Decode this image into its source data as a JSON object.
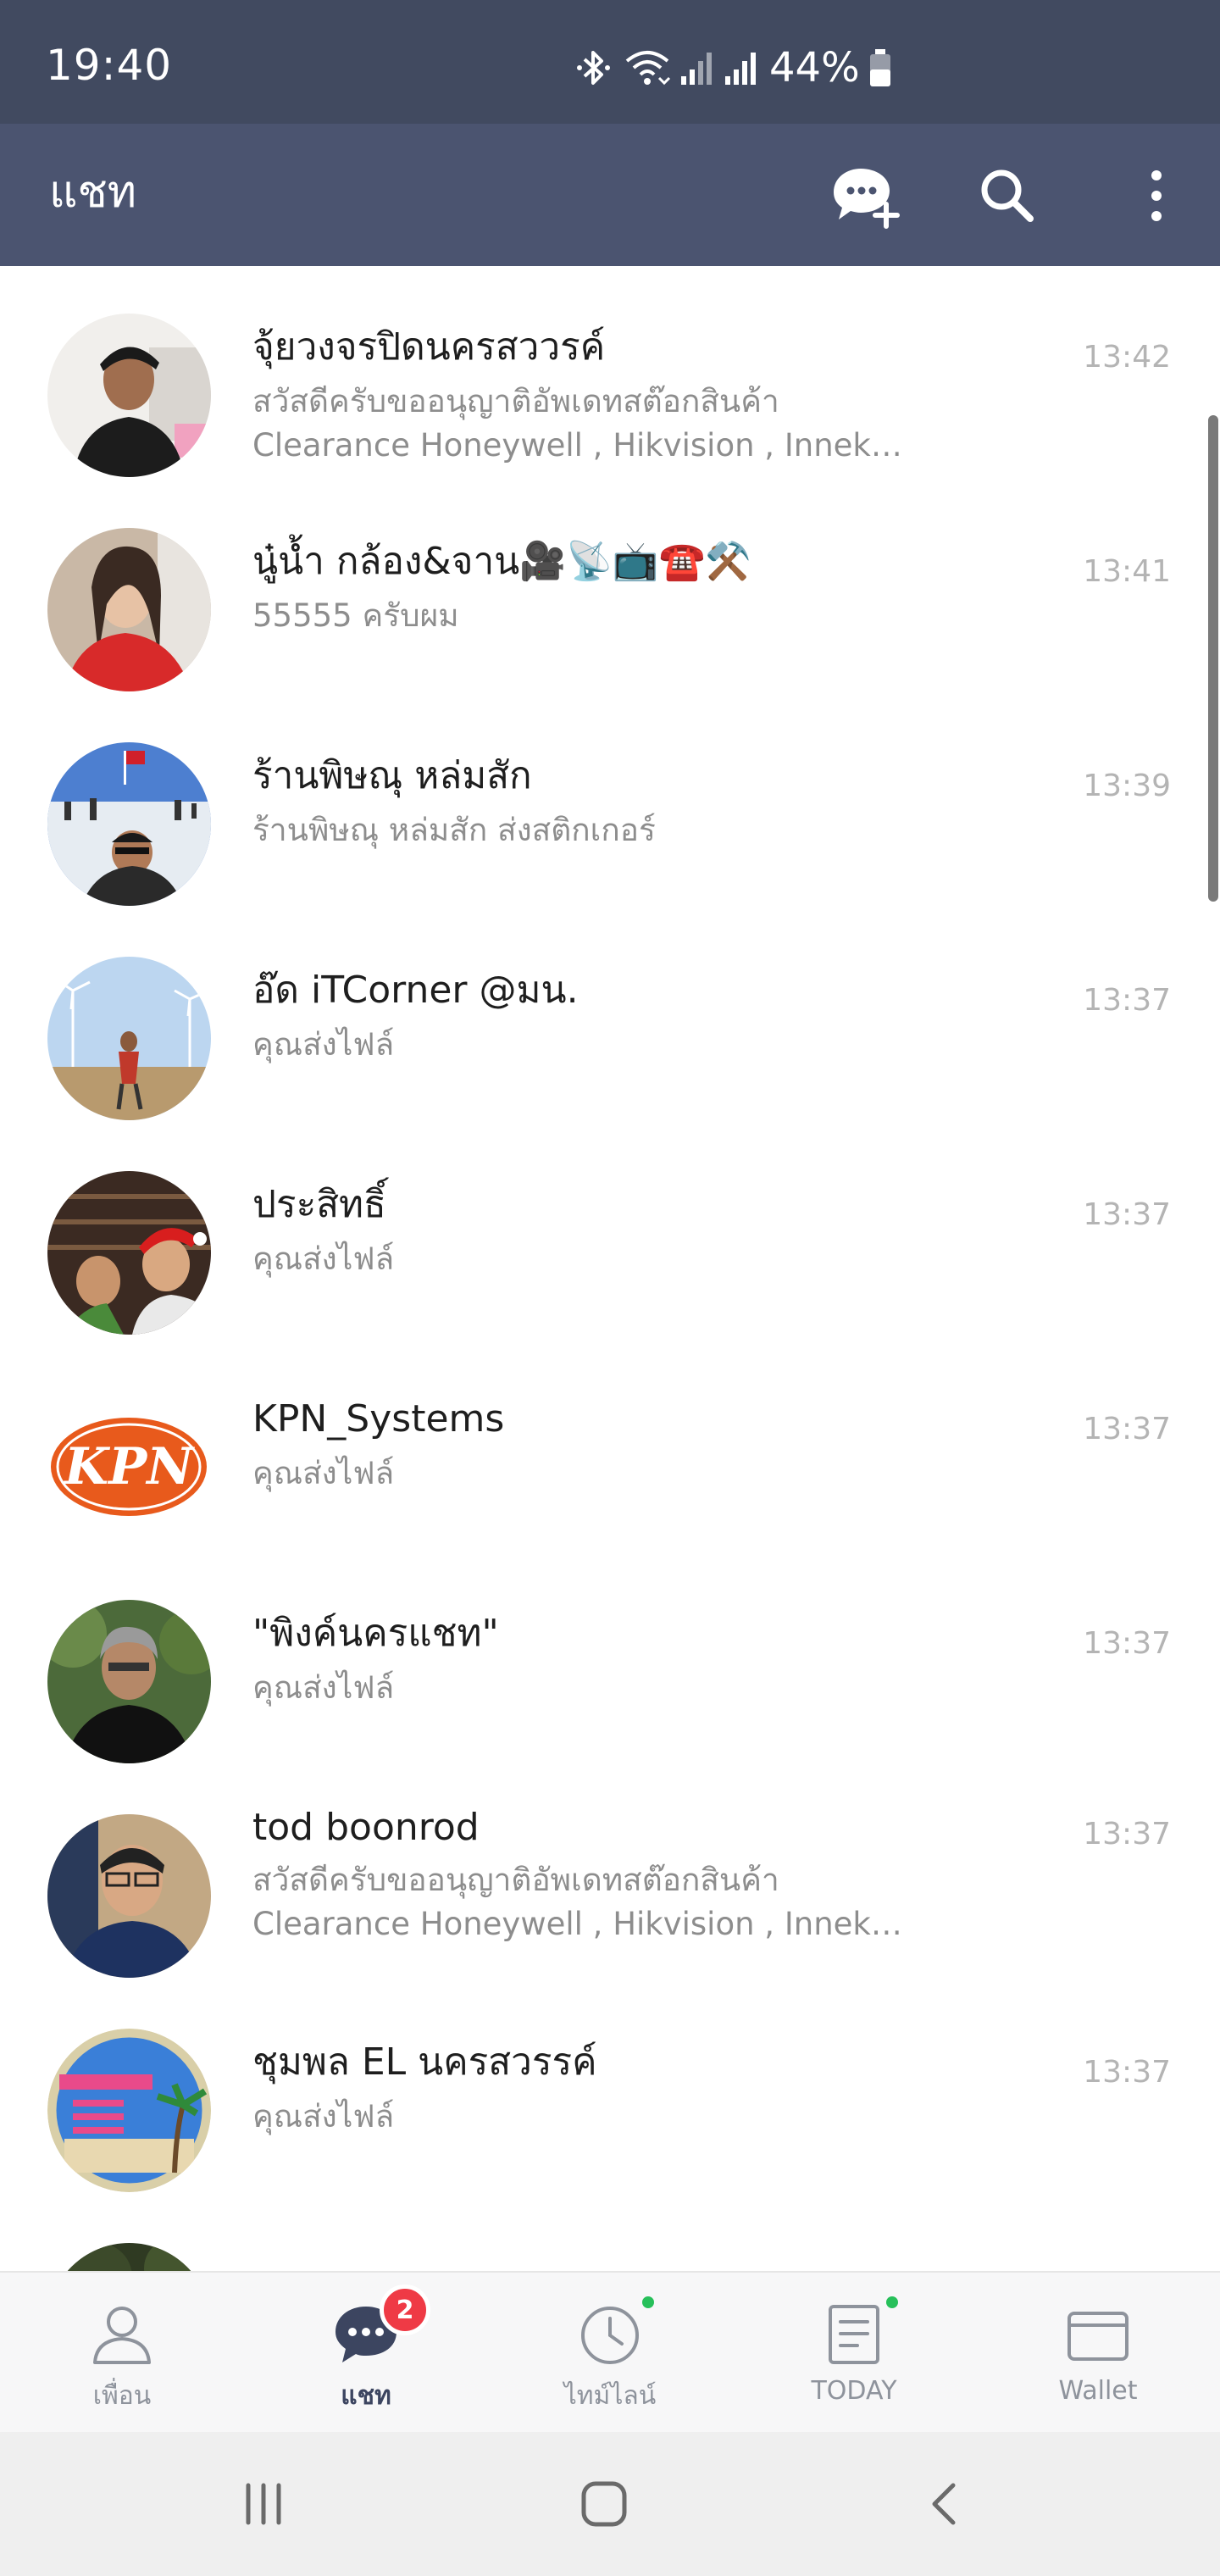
{
  "status_bar": {
    "time": "19:40",
    "battery": "44%"
  },
  "header": {
    "title": "แชท"
  },
  "chats": [
    {
      "name": "จุ้ยวงจรปิดนครสววรค์",
      "message": "สวัสดีครับขออนุญาติอัพเดทสต๊อกสินค้า",
      "message2": "Clearance Honeywell , Hikvision , Innekt ...",
      "time": "13:42"
    },
    {
      "name": "นู๋น้ำ กล้อง&จาน🎥📡📺☎️⚒️",
      "message": "55555 ครับผม",
      "time": "13:41"
    },
    {
      "name": "ร้านพิษณุ หล่มสัก",
      "message": "ร้านพิษณุ หล่มสัก ส่งสติกเกอร์",
      "time": "13:39"
    },
    {
      "name": "อ๊ด  iTCorner @มน.",
      "message": "คุณส่งไฟล์",
      "time": "13:37"
    },
    {
      "name": "ประสิทธิ์",
      "message": "คุณส่งไฟล์",
      "time": "13:37"
    },
    {
      "name": "KPN_Systems",
      "message": "คุณส่งไฟล์",
      "time": "13:37"
    },
    {
      "name": "\"พิงค์นครแชท\"",
      "message": "คุณส่งไฟล์",
      "time": "13:37"
    },
    {
      "name": "tod   boonrod",
      "message": "สวัสดีครับขออนุญาติอัพเดทสต๊อกสินค้า",
      "message2": "Clearance Honeywell , Hikvision , Innekt ...",
      "time": "13:37"
    },
    {
      "name": "ชุมพล EL นครสวรรค์",
      "message": "คุณส่งไฟล์",
      "time": "13:37"
    }
  ],
  "avatars": {
    "kpn_logo_text": "KPN"
  },
  "tabs": [
    {
      "label": "เพื่อน",
      "icon": "person-icon"
    },
    {
      "label": "แชท",
      "icon": "chat-bubble-icon",
      "badge": "2",
      "active": true
    },
    {
      "label": "ไทม์ไลน์",
      "icon": "clock-icon"
    },
    {
      "label": "TODAY",
      "icon": "news-icon"
    },
    {
      "label": "Wallet",
      "icon": "wallet-icon"
    }
  ],
  "colors": {
    "status_bar": "#414a60",
    "header": "#4b5470",
    "badge": "#ef3a45",
    "new_dot": "#27c05a"
  }
}
